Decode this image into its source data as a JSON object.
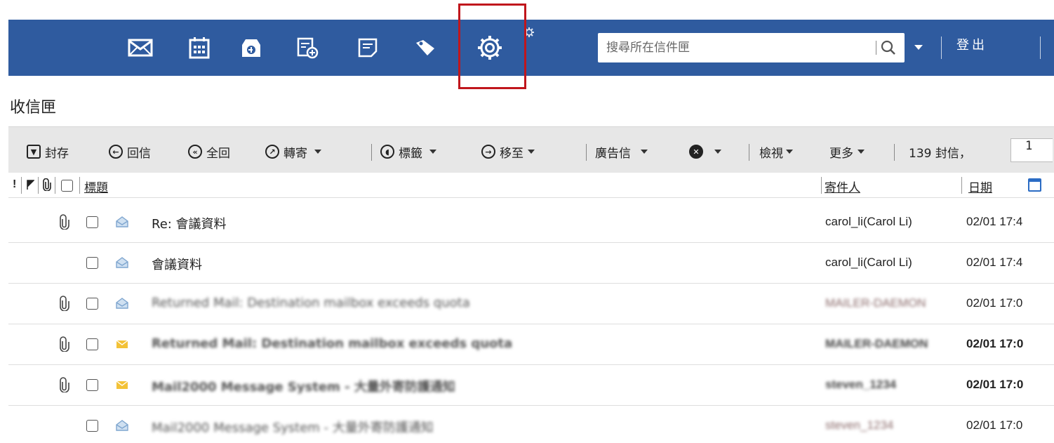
{
  "app": {
    "toolbar_icons": [
      "mail-icon",
      "calendar-icon",
      "contacts-icon",
      "compose-icon",
      "notes-icon",
      "tag-icon",
      "settings-gear-icon",
      "small-gear-icon"
    ],
    "search": {
      "placeholder": "搜尋所在信件匣"
    },
    "logout_label": "登出",
    "colors": {
      "topbar": "#2f5b9f",
      "highlight": "#c0161c",
      "toolbar_bg": "#e7e7e7",
      "unread_envelope": "#f3c237",
      "read_envelope": "#8db2d6"
    }
  },
  "folder": {
    "title": "收信匣"
  },
  "actions": {
    "archive": "封存",
    "reply": "回信",
    "reply_all": "全回",
    "forward": "轉寄",
    "label": "標籤",
    "move_to": "移至",
    "spam": "廣告信",
    "view": "檢視",
    "more": "更多",
    "count_text": "139 封信，",
    "page_value": "1"
  },
  "columns": {
    "subject": "標題",
    "sender": "寄件人",
    "date": "日期"
  },
  "messages": [
    {
      "subject": "Re: 會議資料",
      "sender": "carol_li(Carol Li)",
      "date": "02/01 17:4",
      "attachment": true,
      "unread": false,
      "blurred": false
    },
    {
      "subject": "會議資料",
      "sender": "carol_li(Carol Li)",
      "date": "02/01 17:4",
      "attachment": false,
      "unread": false,
      "blurred": false
    },
    {
      "subject": "Returned Mail: Destination mailbox exceeds quota",
      "sender": "MAILER-DAEMON",
      "date": "02/01 17:0",
      "attachment": true,
      "unread": false,
      "blurred": true
    },
    {
      "subject": "Returned Mail: Destination mailbox exceeds quota",
      "sender": "MAILER-DAEMON",
      "date": "02/01 17:0",
      "attachment": true,
      "unread": true,
      "blurred": true
    },
    {
      "subject": "Mail2000 Message System - 大量外寄防護通知",
      "sender": "steven_1234",
      "date": "02/01 17:0",
      "attachment": true,
      "unread": true,
      "blurred": true
    },
    {
      "subject": "Mail2000 Message System - 大量外寄防護通知",
      "sender": "steven_1234",
      "date": "02/01 17:0",
      "attachment": false,
      "unread": false,
      "blurred": true
    }
  ]
}
